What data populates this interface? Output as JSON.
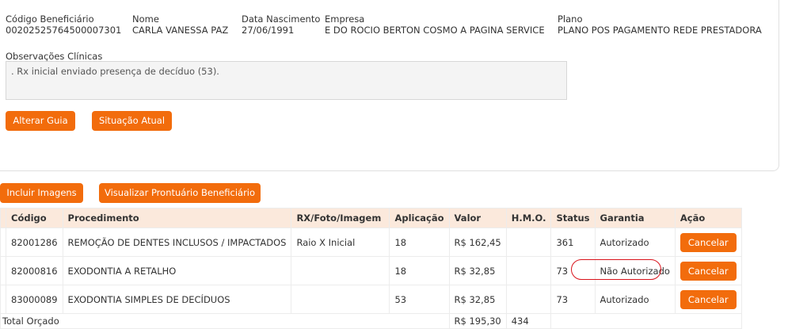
{
  "beneficiary": {
    "codigo_label": "Código Beneficiário",
    "codigo_value": "00202525764500007301",
    "nome_label": "Nome",
    "nome_value": "CARLA VANESSA PAZ",
    "nascimento_label": "Data Nascimento",
    "nascimento_value": "27/06/1991",
    "empresa_label": "Empresa",
    "empresa_value": "E DO ROCIO BERTON COSMO A PAGINA SERVICE",
    "plano_label": "Plano",
    "plano_value": "PLANO POS PAGAMENTO REDE PRESTADORA"
  },
  "observacoes": {
    "label": "Observações Clínicas",
    "text": ". Rx inicial enviado presença de decíduo (53)."
  },
  "buttons": {
    "alterar": "Alterar Guia",
    "situacao": "Situação Atual",
    "incluir": "Incluir Imagens",
    "visualizar": "Visualizar Prontuário Beneficiário"
  },
  "table": {
    "headers": [
      "Código",
      "Procedimento",
      "RX/Foto/Imagem",
      "Aplicação",
      "Valor",
      "H.M.O.",
      "Status",
      "Garantia",
      "Ação"
    ],
    "rows": [
      {
        "codigo": "82001286",
        "procedimento": "REMOÇÃO DE DENTES INCLUSOS / IMPACTADOS",
        "rx": "Raio X Inicial",
        "aplicacao": "18",
        "valor": "R$ 162,45",
        "hmo": "",
        "status": "361",
        "garantia": "Autorizado",
        "acao": "Cancelar"
      },
      {
        "codigo": "82000816",
        "procedimento": "EXODONTIA A RETALHO",
        "rx": "",
        "aplicacao": "18",
        "valor": "R$ 32,85",
        "hmo": "",
        "status": "73",
        "garantia": "Não Autorizado",
        "acao": "Cancelar"
      },
      {
        "codigo": "83000089",
        "procedimento": "EXODONTIA SIMPLES DE DECÍDUOS",
        "rx": "",
        "aplicacao": "53",
        "valor": "R$ 32,85",
        "hmo": "",
        "status": "73",
        "garantia": "Autorizado",
        "acao": "Cancelar"
      }
    ],
    "total_label": "Total Orçado",
    "total_valor": "R$ 195,30",
    "total_hmo": "434"
  },
  "colors": {
    "accent": "#f26c0c",
    "header_bg": "#fbe9dc",
    "annotation": "#d9141c"
  }
}
